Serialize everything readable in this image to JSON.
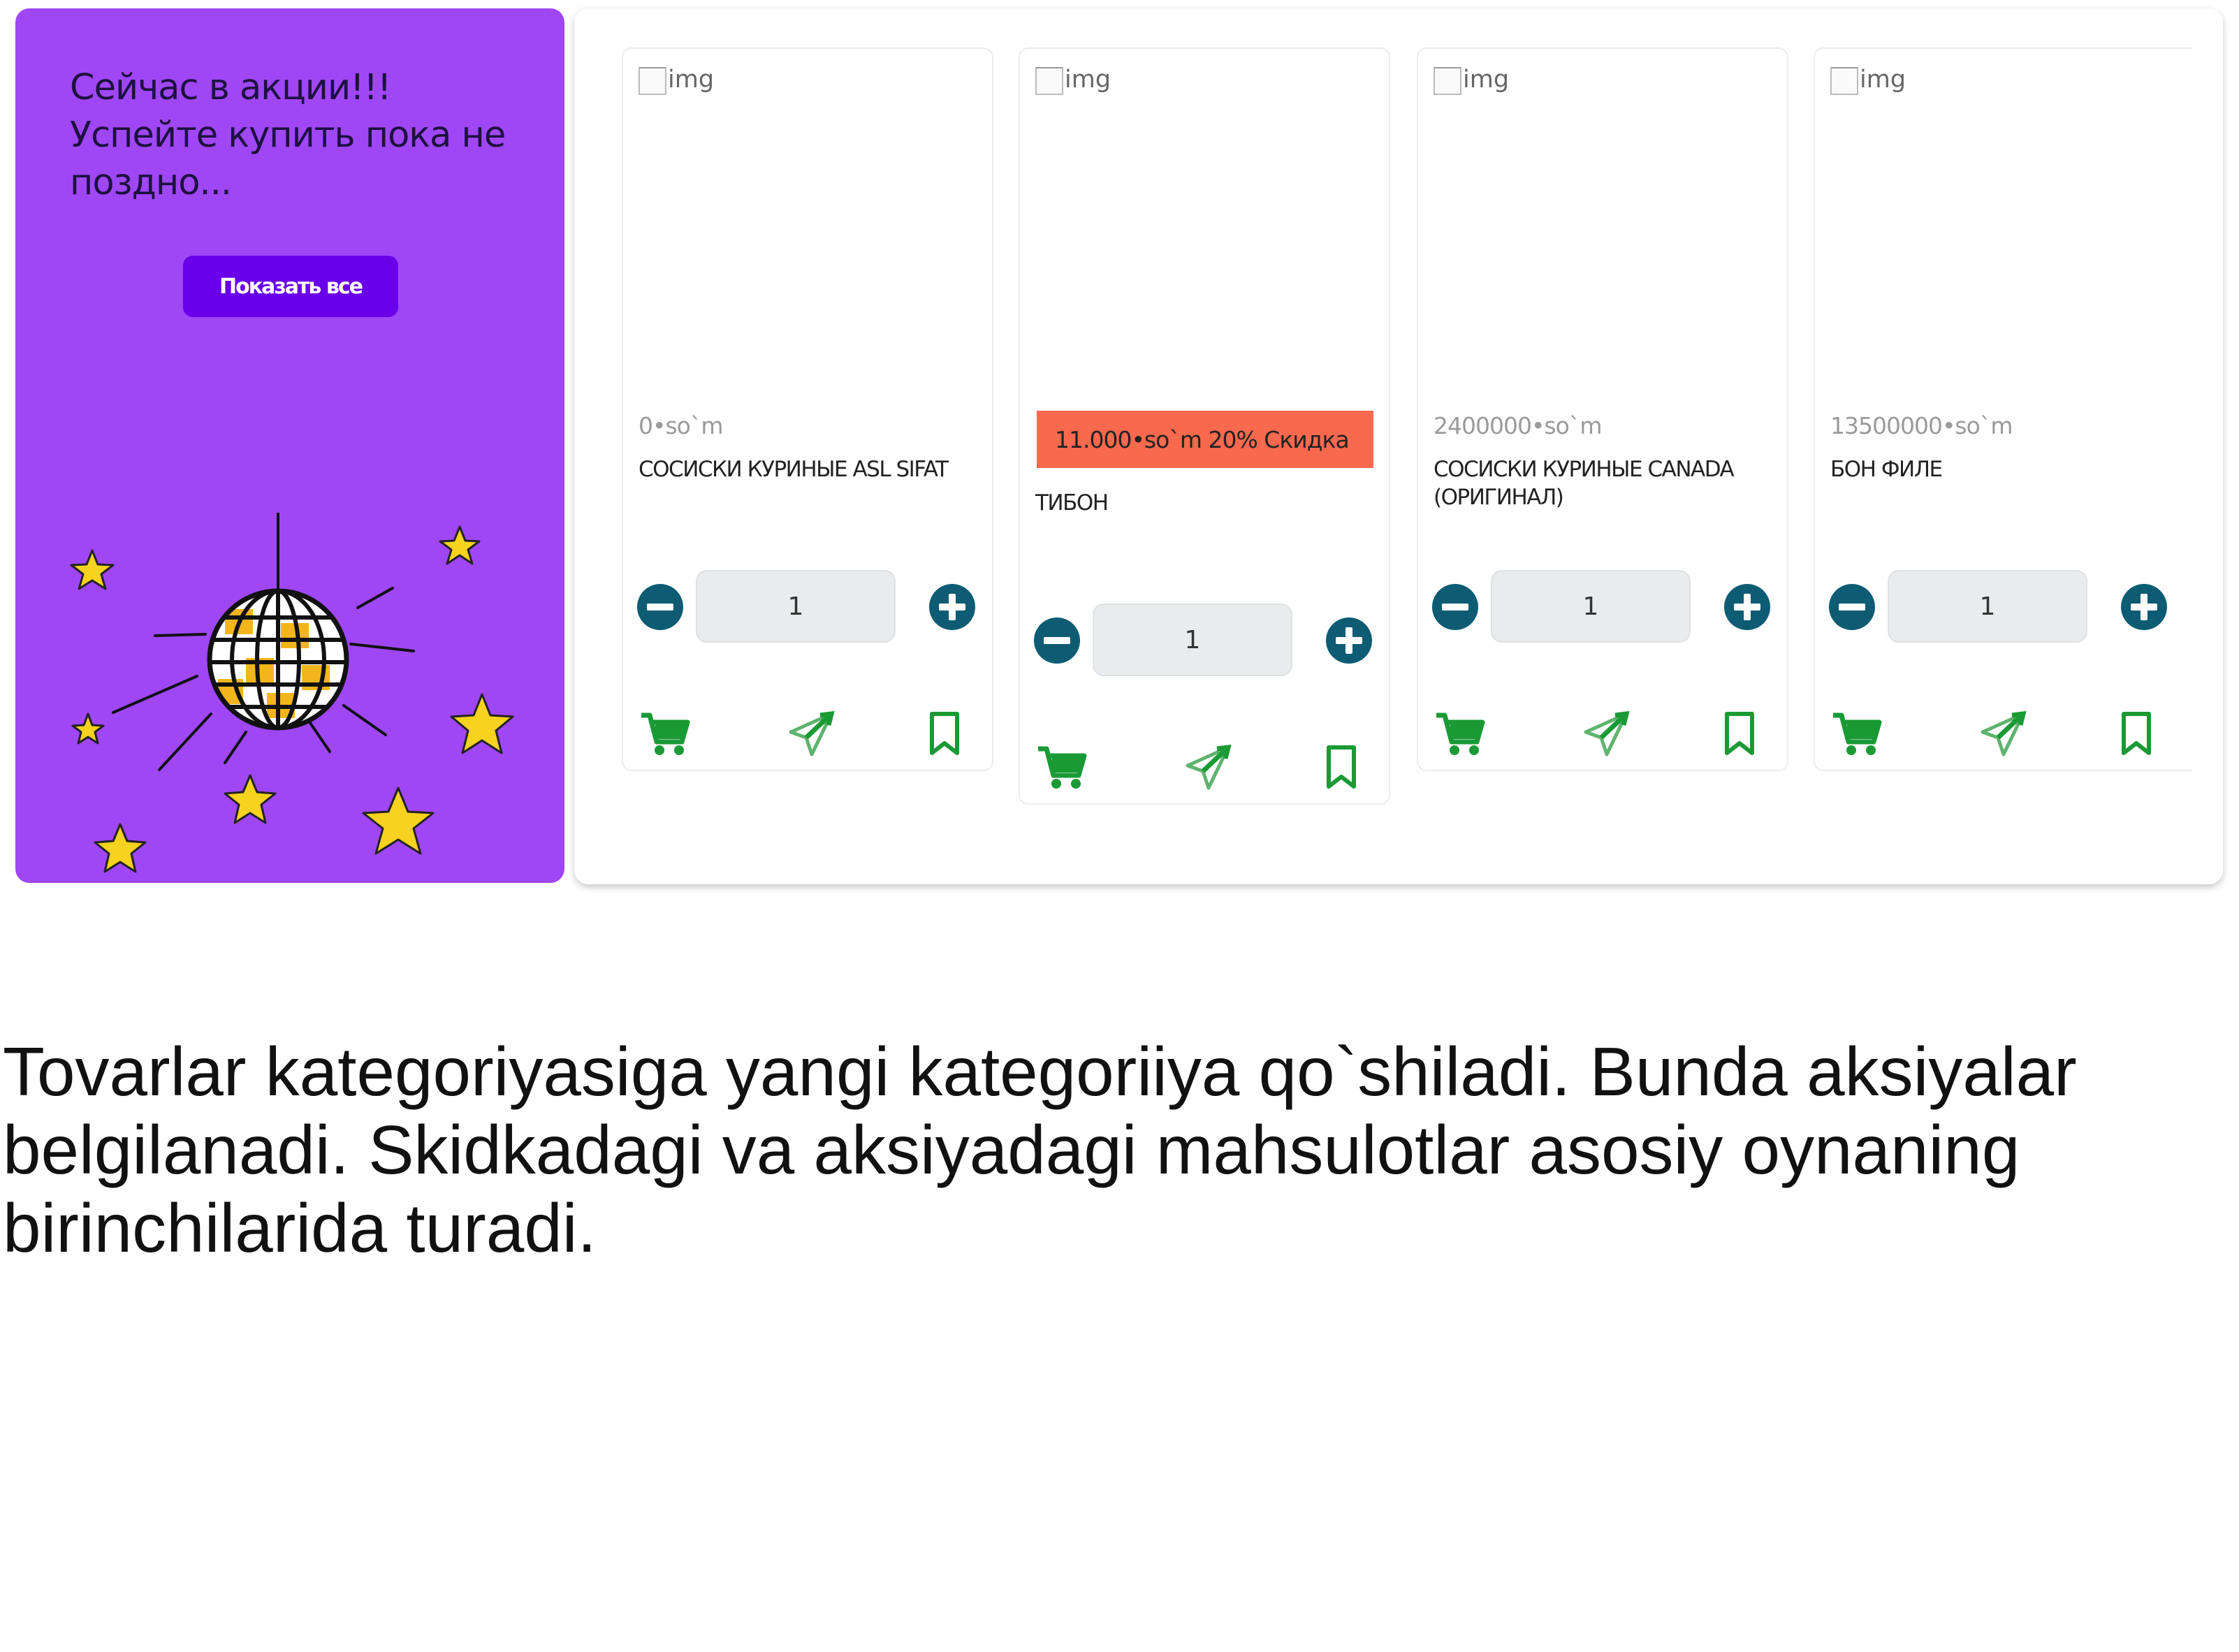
{
  "promo": {
    "text_line1": "Сейчас в акции!!!",
    "text_line2": "Успейте купить пока не",
    "text_line3": "поздно...",
    "button_label": "Показать все",
    "bg_color": "#9f47f5",
    "button_color": "#6a00ea",
    "illustration": "disco-ball-with-stars"
  },
  "image_placeholder": "img",
  "products": [
    {
      "price": "0•so`m",
      "discount": "",
      "name": "СОСИСКИ КУРИНЫЕ ASL SIFAT",
      "quantity": "1"
    },
    {
      "price": "",
      "discount": "11.000•so`m 20% Скидка",
      "name": "ТИБОН",
      "quantity": "1"
    },
    {
      "price": "2400000•so`m",
      "discount": "",
      "name": "СОСИСКИ КУРИНЫЕ CANADA (ОРИГИНАЛ)",
      "quantity": "1"
    },
    {
      "price": "13500000•so`m",
      "discount": "",
      "name": "БОН ФИЛЕ",
      "quantity": "1"
    }
  ],
  "icons": {
    "minus": "minus-circle-icon",
    "plus": "plus-circle-icon",
    "cart": "shopping-cart-icon",
    "send": "send-icon",
    "bookmark": "bookmark-icon"
  },
  "colors": {
    "accent_green": "#1a9a35",
    "button_teal": "#0d5c73",
    "discount_bg": "#f8694e"
  },
  "caption": "Tovarlar kategoriyasiga yangi kategoriiya qo`shiladi. Bunda aksiyalar belgilanadi. Skidkadagi va aksiyadagi mahsulotlar asosiy oynaning birinchilarida turadi."
}
